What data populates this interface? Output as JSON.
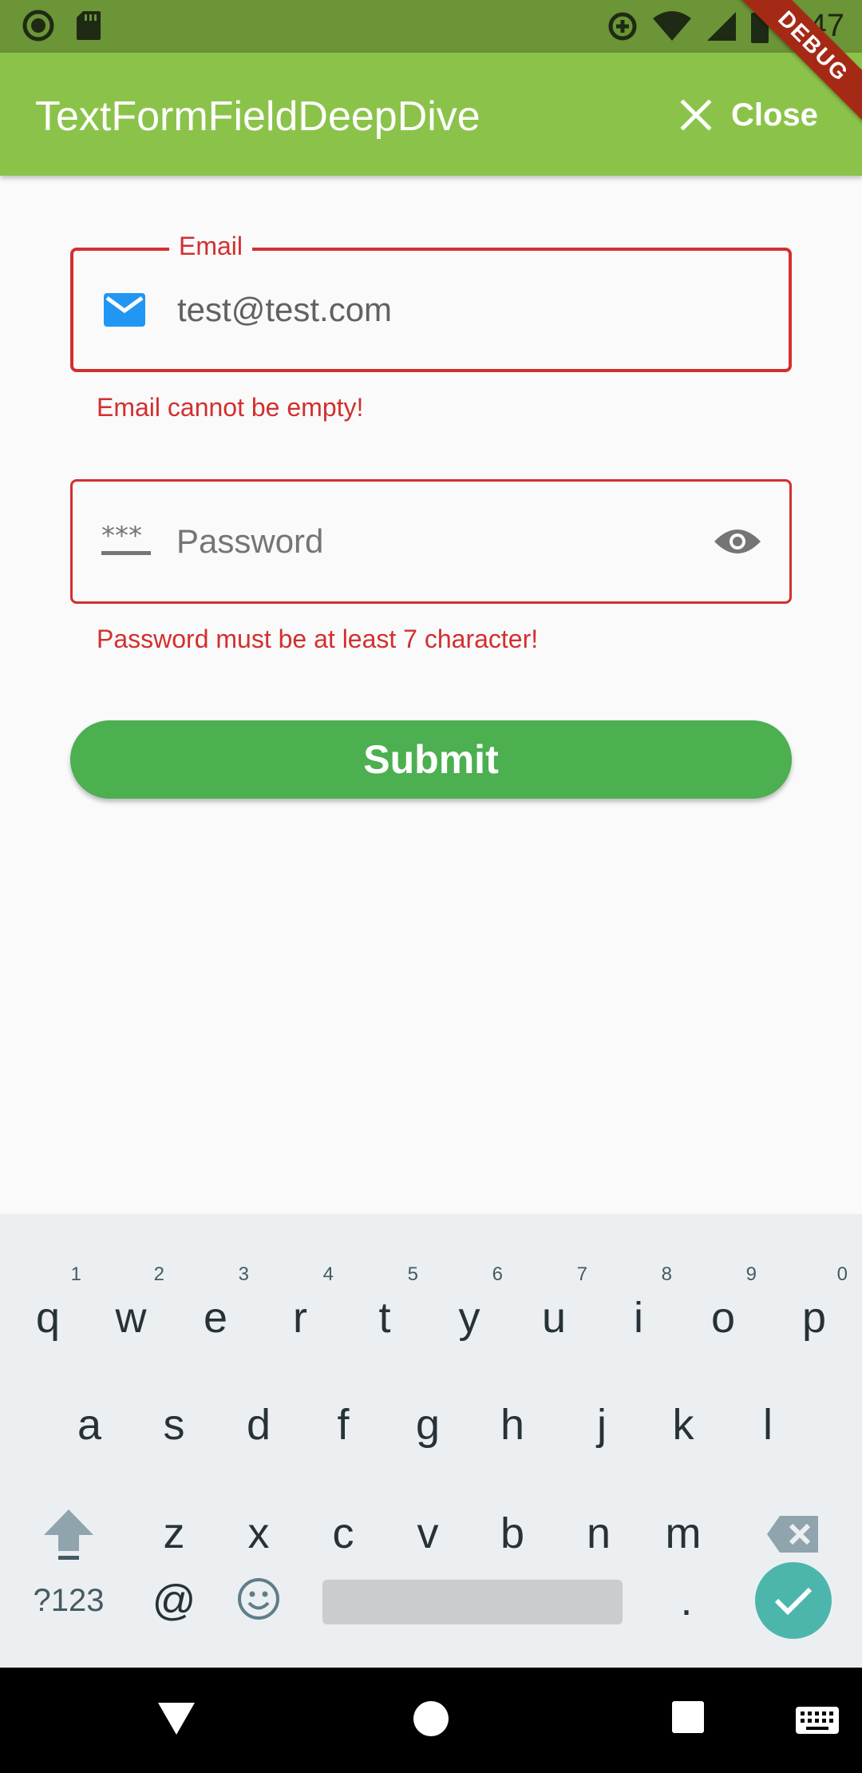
{
  "status_bar": {
    "time": "4:47",
    "icons": [
      "circle-notification-icon",
      "sd-card-icon",
      "data-saver-icon",
      "wifi-icon",
      "signal-icon",
      "battery-icon"
    ]
  },
  "app_bar": {
    "title": "TextFormFieldDeepDive",
    "close_label": "Close",
    "debug_label": "DEBUG",
    "color": "#8bc34a"
  },
  "form": {
    "email": {
      "label": "Email",
      "value": "test@test.com",
      "error": "Email cannot be empty!",
      "icon": "email-icon"
    },
    "password": {
      "placeholder": "Password",
      "error": "Password must be at least 7 character!",
      "prefix_icon": "password-icon",
      "suffix_icon": "eye-icon"
    },
    "submit_label": "Submit",
    "error_color": "#d32f2f",
    "submit_color": "#4caf50"
  },
  "keyboard": {
    "row1": [
      {
        "key": "q",
        "hint": "1"
      },
      {
        "key": "w",
        "hint": "2"
      },
      {
        "key": "e",
        "hint": "3"
      },
      {
        "key": "r",
        "hint": "4"
      },
      {
        "key": "t",
        "hint": "5"
      },
      {
        "key": "y",
        "hint": "6"
      },
      {
        "key": "u",
        "hint": "7"
      },
      {
        "key": "i",
        "hint": "8"
      },
      {
        "key": "o",
        "hint": "9"
      },
      {
        "key": "p",
        "hint": "0"
      }
    ],
    "row2": [
      "a",
      "s",
      "d",
      "f",
      "g",
      "h",
      "j",
      "k",
      "l"
    ],
    "row3": [
      "z",
      "x",
      "c",
      "v",
      "b",
      "n",
      "m"
    ],
    "symbols_label": "?123",
    "at_label": "@",
    "period_label": "."
  },
  "nav_bar": {
    "icons": [
      "back-icon",
      "home-icon",
      "recents-icon",
      "keyboard-switch-icon"
    ]
  }
}
